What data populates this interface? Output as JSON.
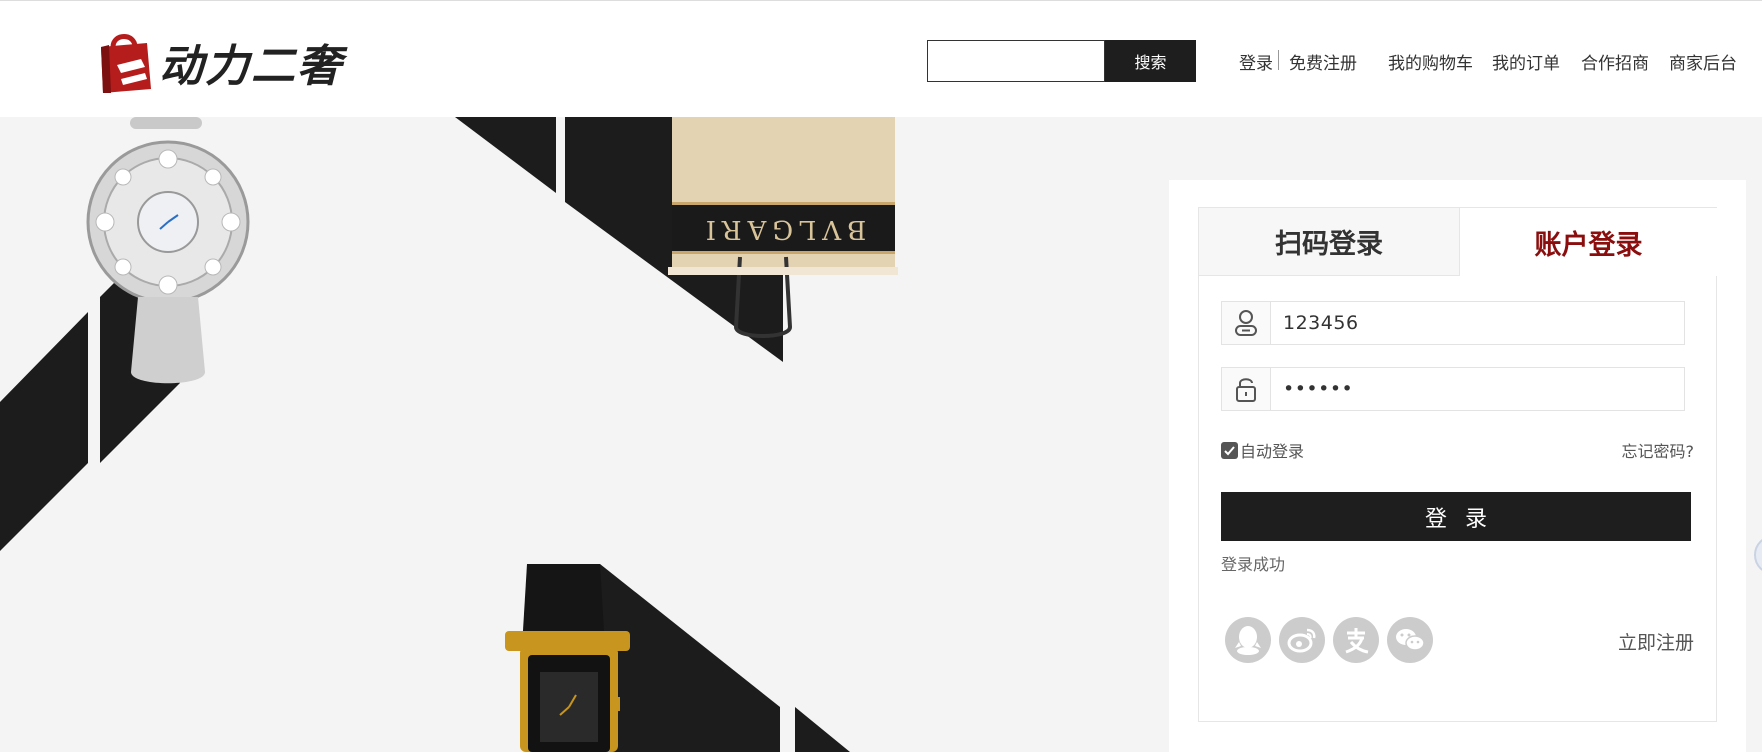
{
  "brand": {
    "name": "动力二奢",
    "logo_icon": "shopping-bag-icon",
    "color": "#b51c1c"
  },
  "search": {
    "value": "",
    "button_label": "搜索"
  },
  "nav": {
    "login": "登录",
    "register": "免费注册",
    "cart": "我的购物车",
    "orders": "我的订单",
    "partner": "合作招商",
    "merchant": "商家后台"
  },
  "banner": {
    "bag_brand_text": "BVLGARI"
  },
  "login_panel": {
    "tabs": [
      "扫码登录",
      "账户登录"
    ],
    "active_tab": "账户登录",
    "username_value": "123456",
    "password_value": "••••••",
    "remember_label": "自动登录",
    "remember_checked": true,
    "forgot_label": "忘记密码?",
    "submit_label": "登录",
    "status_text": "登录成功",
    "social_icons": [
      "qq-icon",
      "weibo-icon",
      "alipay-icon",
      "wechat-icon"
    ],
    "register_link": "立即注册"
  },
  "colors": {
    "accent": "#8b0e0e",
    "button": "#1e1e1e",
    "background": "#f4f4f4"
  }
}
